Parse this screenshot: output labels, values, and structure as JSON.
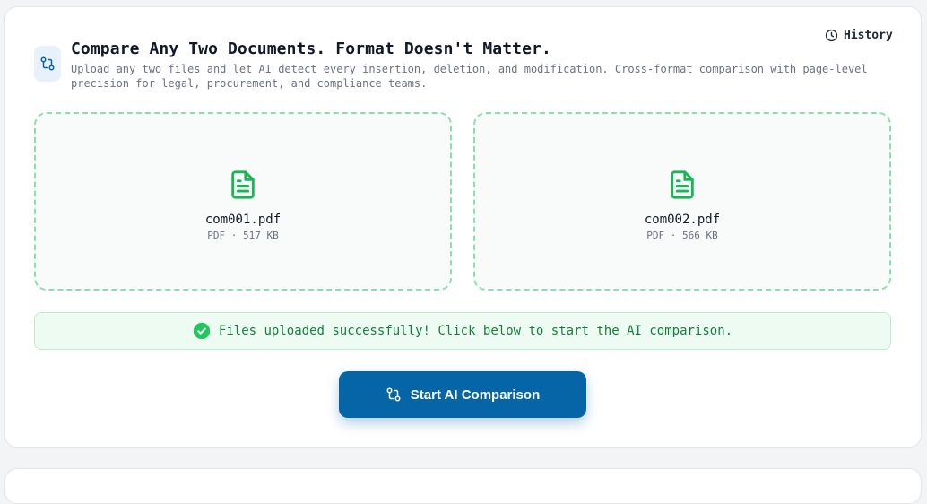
{
  "header": {
    "title": "Compare Any Two Documents. Format Doesn't Matter.",
    "subtitle": "Upload any two files and let AI detect every insertion, deletion, and modification. Cross-format comparison with page-level precision for legal, procurement, and compliance teams.",
    "icon": "git-compare-icon",
    "history_label": "History",
    "history_icon": "clock-icon"
  },
  "files": [
    {
      "name": "com001.pdf",
      "meta": "PDF · 517 KB",
      "icon": "file-text-icon"
    },
    {
      "name": "com002.pdf",
      "meta": "PDF · 566 KB",
      "icon": "file-text-icon"
    }
  ],
  "status": {
    "message": "Files uploaded successfully! Click below to start the AI comparison.",
    "icon": "check-circle-icon",
    "color": "#15803d"
  },
  "action": {
    "label": "Start AI Comparison",
    "icon": "git-compare-icon",
    "color": "#0565a6"
  },
  "colors": {
    "accent": "#0565a6",
    "success": "#22c55e",
    "dropzone_border": "#86e2aa"
  }
}
